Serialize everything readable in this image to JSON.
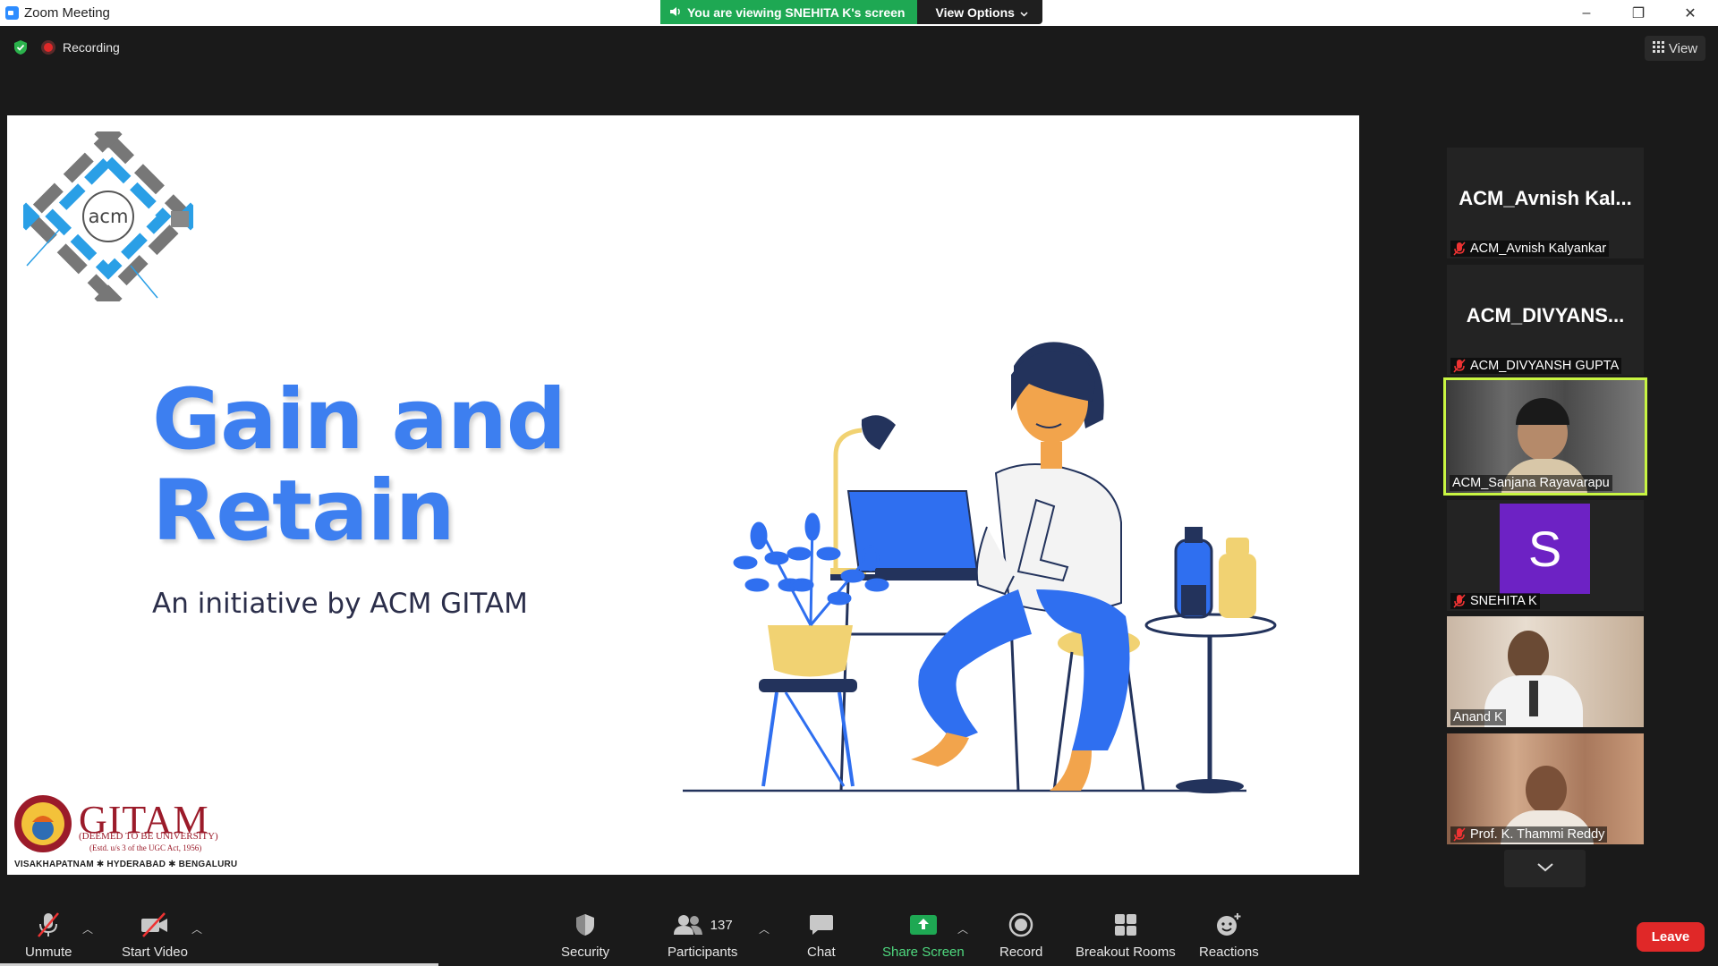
{
  "window": {
    "title": "Zoom Meeting",
    "minimize": "–",
    "restore": "❐",
    "close": "✕"
  },
  "banner": {
    "viewing": "You are viewing SNEHITA K's screen",
    "view_options": "View Options"
  },
  "status": {
    "recording": "Recording"
  },
  "view_button": "View",
  "slide": {
    "title_line1": "Gain and",
    "title_line2": "Retain",
    "subtitle": "An initiative by ACM GITAM",
    "acm_text": "acm",
    "gitam_name": "GITAM",
    "gitam_deemed": "(DEEMED TO BE UNIVERSITY)",
    "gitam_estd": "(Estd. u/s 3 of the UGC Act, 1956)",
    "gitam_cities": "VISAKHAPATNAM ✱ HYDERABAD ✱ BENGALURU"
  },
  "participants": [
    {
      "display": "ACM_Avnish  Kal...",
      "label": "ACM_Avnish Kalyankar",
      "muted": true,
      "kind": "name"
    },
    {
      "display": "ACM_DIVYANS...",
      "label": "ACM_DIVYANSH GUPTA",
      "muted": true,
      "kind": "name"
    },
    {
      "display": "",
      "label": "ACM_Sanjana Rayavarapu",
      "muted": false,
      "kind": "video"
    },
    {
      "display": "S",
      "label": "SNEHITA K",
      "muted": true,
      "kind": "avatar"
    },
    {
      "display": "",
      "label": "Anand K",
      "muted": false,
      "kind": "video"
    },
    {
      "display": "",
      "label": "Prof. K. Thammi Reddy",
      "muted": true,
      "kind": "video"
    }
  ],
  "toolbar": {
    "unmute": "Unmute",
    "start_video": "Start Video",
    "security": "Security",
    "participants": "Participants",
    "participants_count": "137",
    "chat": "Chat",
    "share_screen": "Share Screen",
    "record": "Record",
    "breakout_rooms": "Breakout Rooms",
    "reactions": "Reactions",
    "leave": "Leave"
  },
  "colors": {
    "accent_blue": "#3d7ff0",
    "banner_green": "#1ea853",
    "leave_red": "#e02828",
    "speaker_highlight": "#c8f542",
    "avatar_purple": "#6d22c4"
  }
}
